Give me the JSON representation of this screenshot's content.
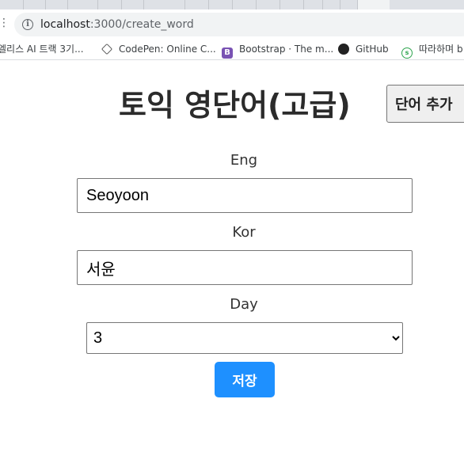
{
  "browser": {
    "url_host": "localhost",
    "url_rest": ":3000/create_word",
    "bookmarks": [
      {
        "label": "엘리스 AI 트랙 3기...",
        "icon": "elice-icon"
      },
      {
        "label": "CodePen: Online C...",
        "icon": "codepen-icon"
      },
      {
        "label": "Bootstrap · The m...",
        "icon": "bootstrap-icon"
      },
      {
        "label": "GitHub",
        "icon": "github-icon"
      },
      {
        "label": "따라하며 b",
        "icon": "green-circle-icon"
      }
    ]
  },
  "page": {
    "title": "토익 영단어(고급)",
    "add_word_label": "단어 추가"
  },
  "form": {
    "eng_label": "Eng",
    "eng_value": "Seoyoon",
    "kor_label": "Kor",
    "kor_value": "서윤",
    "day_label": "Day",
    "day_value": "3",
    "save_label": "저장"
  },
  "colors": {
    "accent": "#1e90ff"
  }
}
